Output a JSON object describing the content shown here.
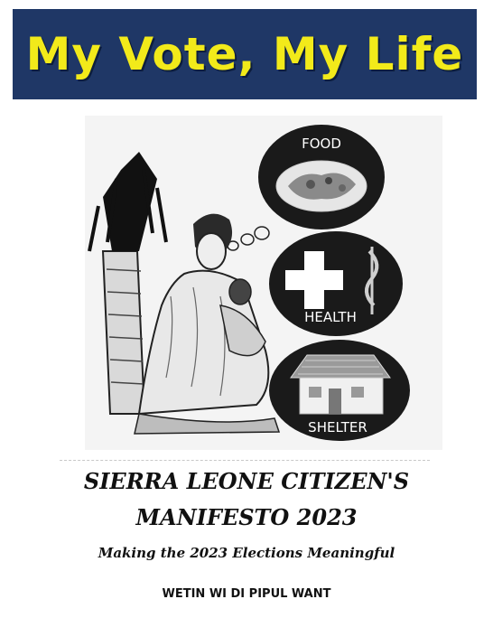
{
  "banner": {
    "title": "My Vote, My Life"
  },
  "illustration": {
    "bubbles": [
      {
        "label": "FOOD"
      },
      {
        "label": "HEALTH"
      },
      {
        "label": "SHELTER"
      }
    ]
  },
  "main_title": {
    "line1": "SIERRA LEONE CITIZEN'S",
    "line2": "MANIFESTO 2023"
  },
  "subtitle": "Making the 2023 Elections Meaningful",
  "tagline": "WETIN WI DI PIPUL WANT",
  "colors": {
    "banner_bg": "#1f3766",
    "banner_text": "#f2ea1a",
    "bubble_fill": "#1a1a1a"
  }
}
